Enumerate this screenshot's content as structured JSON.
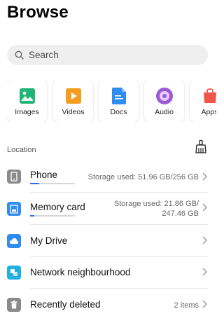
{
  "page": {
    "title": "Browse"
  },
  "search": {
    "placeholder": "Search"
  },
  "categories": [
    {
      "label": "Images",
      "icon": "images-icon",
      "color": "#21b575"
    },
    {
      "label": "Videos",
      "icon": "videos-icon",
      "color": "#f59d20"
    },
    {
      "label": "Docs",
      "icon": "docs-icon",
      "color": "#2f8cf0"
    },
    {
      "label": "Audio",
      "icon": "audio-icon",
      "color": "#9b59d9"
    },
    {
      "label": "Apps",
      "icon": "apps-icon",
      "color": "#f0564a"
    }
  ],
  "location": {
    "label": "Location",
    "clean_icon": "broom-icon",
    "items": [
      {
        "title": "Phone",
        "icon": "phone-icon",
        "icon_color": "#8a8a8a",
        "detail": "Storage used: 51.96 GB/256 GB",
        "usage": 0.203
      },
      {
        "title": "Memory card",
        "icon": "sd-card-icon",
        "icon_color": "#2f8cf0",
        "detail_line1": "Storage used: 21.86 GB/",
        "detail_line2": "247.46 GB",
        "usage": 0.088
      },
      {
        "title": "My Drive",
        "icon": "cloud-drive-icon",
        "icon_color": "#2f8cf0"
      },
      {
        "title": "Network neighbourhood",
        "icon": "network-icon",
        "icon_color": "#1fb0e0"
      },
      {
        "title": "Recently deleted",
        "icon": "trash-icon",
        "icon_color": "#8a8a8a",
        "detail": "2 items"
      }
    ]
  },
  "colors": {
    "accent": "#256fff",
    "search_bg": "#efefef"
  }
}
